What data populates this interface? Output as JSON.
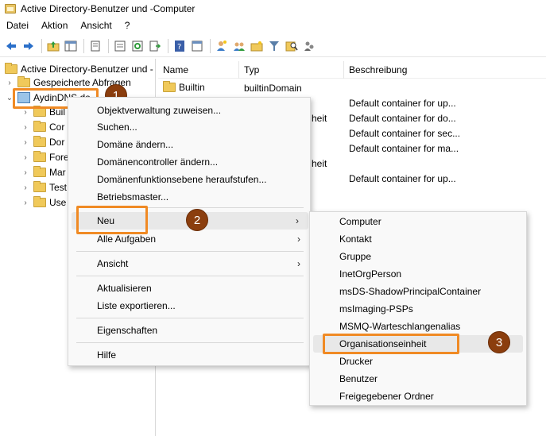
{
  "window": {
    "title": "Active Directory-Benutzer und -Computer"
  },
  "menubar": [
    "Datei",
    "Aktion",
    "Ansicht",
    "?"
  ],
  "toolbar": {
    "icons": [
      "back-arrow-icon",
      "forward-arrow-icon",
      "up-folder-icon",
      "show-tree-icon",
      "copy-icon",
      "properties-icon",
      "refresh-icon",
      "export-icon",
      "help-icon",
      "console-icon",
      "add-user-icon",
      "add-group-icon",
      "add-ou-icon",
      "filter-icon",
      "find-icon",
      "delegate-icon"
    ]
  },
  "tree": {
    "root": "Active Directory-Benutzer und -",
    "saved_queries": "Gespeicherte Abfragen",
    "domain": "AydinDNS.de",
    "children": [
      "Buil",
      "Cor",
      "Dor",
      "Fore",
      "Mar",
      "Test",
      "Use"
    ]
  },
  "list": {
    "columns": [
      "Name",
      "Typ",
      "Beschreibung"
    ],
    "rows": [
      {
        "name": "Builtin",
        "type": "builtinDomain",
        "desc": ""
      },
      {
        "name": "",
        "type": "",
        "desc": "Default container for up..."
      },
      {
        "name": "",
        "type": "heit",
        "desc": "Default container for do..."
      },
      {
        "name": "",
        "type": "",
        "desc": "Default container for sec..."
      },
      {
        "name": "",
        "type": "",
        "desc": "Default container for ma..."
      },
      {
        "name": "",
        "type": "heit",
        "desc": ""
      },
      {
        "name": "",
        "type": "",
        "desc": "Default container for up..."
      }
    ]
  },
  "context_menu": {
    "items": [
      "Objektverwaltung zuweisen...",
      "Suchen...",
      "Domäne ändern...",
      "Domänencontroller ändern...",
      "Domänenfunktionsebene heraufstufen...",
      "Betriebsmaster...",
      "Neu",
      "Alle Aufgaben",
      "Ansicht",
      "Aktualisieren",
      "Liste exportieren...",
      "Eigenschaften",
      "Hilfe"
    ]
  },
  "submenu": {
    "items": [
      "Computer",
      "Kontakt",
      "Gruppe",
      "InetOrgPerson",
      "msDS-ShadowPrincipalContainer",
      "msImaging-PSPs",
      "MSMQ-Warteschlangenalias",
      "Organisationseinheit",
      "Drucker",
      "Benutzer",
      "Freigegebener Ordner"
    ]
  },
  "annotations": {
    "badge1": "1",
    "badge2": "2",
    "badge3": "3",
    "color": "#f08a24"
  }
}
